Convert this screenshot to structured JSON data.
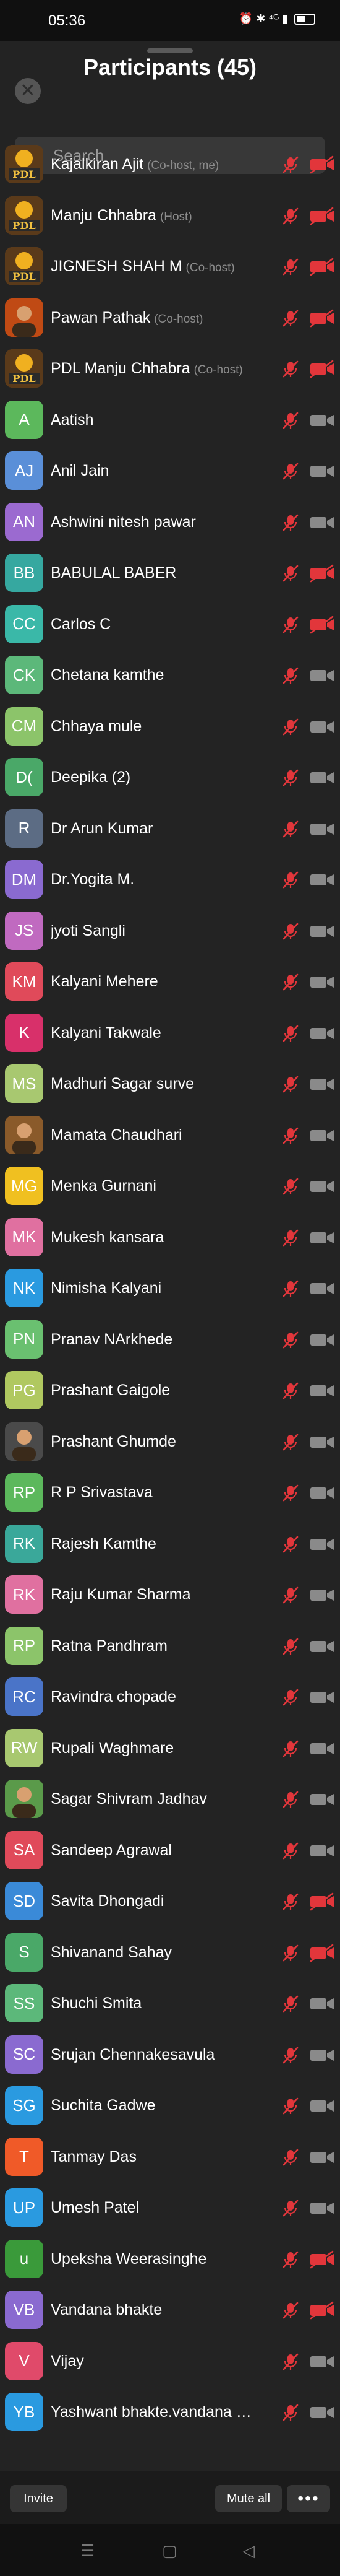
{
  "status": {
    "time": "05:36",
    "icons": "⏰ ✱ ⁴ᴳ ▮"
  },
  "header": {
    "title": "Participants (45)",
    "close_icon": "✕"
  },
  "search": {
    "placeholder": "Search"
  },
  "participants": [
    {
      "name": "Kajalkiran Ajit",
      "role": "(Co-host, me)",
      "initials": "",
      "color": "#6a4a2a",
      "pic": "pdl",
      "cam_on": true
    },
    {
      "name": "Manju Chhabra",
      "role": "(Host)",
      "initials": "",
      "color": "#6a4a2a",
      "pic": "pdl",
      "cam_on": true
    },
    {
      "name": "JIGNESH SHAH M",
      "role": "(Co-host)",
      "initials": "",
      "color": "#6a4a2a",
      "pic": "pdl",
      "cam_on": true
    },
    {
      "name": "Pawan Pathak",
      "role": "(Co-host)",
      "initials": "",
      "color": "#c04a14",
      "pic": "photo",
      "cam_on": true
    },
    {
      "name": "PDL Manju Chhabra",
      "role": "(Co-host)",
      "initials": "",
      "color": "#6a4a2a",
      "pic": "pdl",
      "cam_on": true
    },
    {
      "name": "Aatish",
      "role": "",
      "initials": "A",
      "color": "#5cb85c",
      "pic": "",
      "cam_on": false
    },
    {
      "name": "Anil Jain",
      "role": "",
      "initials": "AJ",
      "color": "#5a8fd8",
      "pic": "",
      "cam_on": false
    },
    {
      "name": "Ashwini nitesh pawar",
      "role": "",
      "initials": "AN",
      "color": "#9b6ad0",
      "pic": "",
      "cam_on": false
    },
    {
      "name": "BABULAL BABER",
      "role": "",
      "initials": "BB",
      "color": "#36a8a0",
      "pic": "",
      "cam_on": true
    },
    {
      "name": "Carlos C",
      "role": "",
      "initials": "CC",
      "color": "#3ab8a8",
      "pic": "",
      "cam_on": true
    },
    {
      "name": "Chetana kamthe",
      "role": "",
      "initials": "CK",
      "color": "#5cb87a",
      "pic": "",
      "cam_on": false
    },
    {
      "name": "Chhaya mule",
      "role": "",
      "initials": "CM",
      "color": "#8cc46a",
      "pic": "",
      "cam_on": false
    },
    {
      "name": "Deepika (2)",
      "role": "",
      "initials": "D(",
      "color": "#4aa868",
      "pic": "",
      "cam_on": false
    },
    {
      "name": "Dr Arun Kumar",
      "role": "",
      "initials": "R",
      "color": "#5c6c84",
      "pic": "",
      "cam_on": false
    },
    {
      "name": "Dr.Yogita M.",
      "role": "",
      "initials": "DM",
      "color": "#8a6ad0",
      "pic": "",
      "cam_on": false
    },
    {
      "name": "jyoti Sangli",
      "role": "",
      "initials": "JS",
      "color": "#c06ac0",
      "pic": "",
      "cam_on": false
    },
    {
      "name": "Kalyani Mehere",
      "role": "",
      "initials": "KM",
      "color": "#e04a5a",
      "pic": "",
      "cam_on": false
    },
    {
      "name": "Kalyani Takwale",
      "role": "",
      "initials": "K",
      "color": "#d8306a",
      "pic": "",
      "cam_on": false
    },
    {
      "name": "Madhuri Sagar surve",
      "role": "",
      "initials": "MS",
      "color": "#a8c870",
      "pic": "",
      "cam_on": false
    },
    {
      "name": "Mamata Chaudhari",
      "role": "",
      "initials": "",
      "color": "#8a5a2a",
      "pic": "photo",
      "cam_on": false
    },
    {
      "name": "Menka Gurnani",
      "role": "",
      "initials": "MG",
      "color": "#f0c020",
      "pic": "",
      "cam_on": false
    },
    {
      "name": "Mukesh kansara",
      "role": "",
      "initials": "MK",
      "color": "#e070a0",
      "pic": "",
      "cam_on": false
    },
    {
      "name": "Nimisha Kalyani",
      "role": "",
      "initials": "NK",
      "color": "#2a9ae0",
      "pic": "",
      "cam_on": false
    },
    {
      "name": "Pranav NArkhede",
      "role": "",
      "initials": "PN",
      "color": "#6ac070",
      "pic": "",
      "cam_on": false
    },
    {
      "name": "Prashant Gaigole",
      "role": "",
      "initials": "PG",
      "color": "#b0c860",
      "pic": "",
      "cam_on": false
    },
    {
      "name": "Prashant Ghumde",
      "role": "",
      "initials": "",
      "color": "#4a4a4a",
      "pic": "photo",
      "cam_on": false
    },
    {
      "name": "R P Srivastava",
      "role": "",
      "initials": "RP",
      "color": "#5cb85c",
      "pic": "",
      "cam_on": false
    },
    {
      "name": "Rajesh Kamthe",
      "role": "",
      "initials": "RK",
      "color": "#3aa89a",
      "pic": "",
      "cam_on": false
    },
    {
      "name": "Raju Kumar Sharma",
      "role": "",
      "initials": "RK",
      "color": "#e070a0",
      "pic": "",
      "cam_on": false
    },
    {
      "name": "Ratna Pandhram",
      "role": "",
      "initials": "RP",
      "color": "#8cc46a",
      "pic": "",
      "cam_on": false
    },
    {
      "name": "Ravindra chopade",
      "role": "",
      "initials": "RC",
      "color": "#4a74c8",
      "pic": "",
      "cam_on": false
    },
    {
      "name": "Rupali Waghmare",
      "role": "",
      "initials": "RW",
      "color": "#a8c870",
      "pic": "",
      "cam_on": false
    },
    {
      "name": "Sagar Shivram Jadhav",
      "role": "",
      "initials": "",
      "color": "#5a9a4a",
      "pic": "photo",
      "cam_on": false
    },
    {
      "name": "Sandeep Agrawal",
      "role": "",
      "initials": "SA",
      "color": "#e04a5a",
      "pic": "",
      "cam_on": false
    },
    {
      "name": "Savita Dhongadi",
      "role": "",
      "initials": "SD",
      "color": "#3a8ad8",
      "pic": "",
      "cam_on": true
    },
    {
      "name": "Shivanand  Sahay",
      "role": "",
      "initials": "S",
      "color": "#4aa868",
      "pic": "",
      "cam_on": true
    },
    {
      "name": "Shuchi Smita",
      "role": "",
      "initials": "SS",
      "color": "#5cb87a",
      "pic": "",
      "cam_on": false
    },
    {
      "name": "Srujan Chennakesavula",
      "role": "",
      "initials": "SC",
      "color": "#8a6ad0",
      "pic": "",
      "cam_on": false
    },
    {
      "name": "Suchita Gadwe",
      "role": "",
      "initials": "SG",
      "color": "#2a9ae0",
      "pic": "",
      "cam_on": false
    },
    {
      "name": "Tanmay Das",
      "role": "",
      "initials": "T",
      "color": "#f05a28",
      "pic": "",
      "cam_on": false
    },
    {
      "name": "Umesh Patel",
      "role": "",
      "initials": "UP",
      "color": "#2a9ae0",
      "pic": "",
      "cam_on": false
    },
    {
      "name": "Upeksha Weerasinghe",
      "role": "",
      "initials": "u",
      "color": "#3a9a3a",
      "pic": "",
      "cam_on": true
    },
    {
      "name": "Vandana bhakte",
      "role": "",
      "initials": "VB",
      "color": "#8a6ad0",
      "pic": "",
      "cam_on": true
    },
    {
      "name": "Vijay",
      "role": "",
      "initials": "V",
      "color": "#e04a6a",
      "pic": "",
      "cam_on": false
    },
    {
      "name": "Yashwant bhakte.vandana bhakte",
      "role": "",
      "initials": "YB",
      "color": "#2a9ae0",
      "pic": "",
      "cam_on": false
    }
  ],
  "footer": {
    "invite_label": "Invite",
    "mute_all_label": "Mute all",
    "more_label": "•••"
  },
  "navbar": {
    "menu_icon": "☰",
    "home_icon": "▢",
    "back_icon": "◁"
  }
}
